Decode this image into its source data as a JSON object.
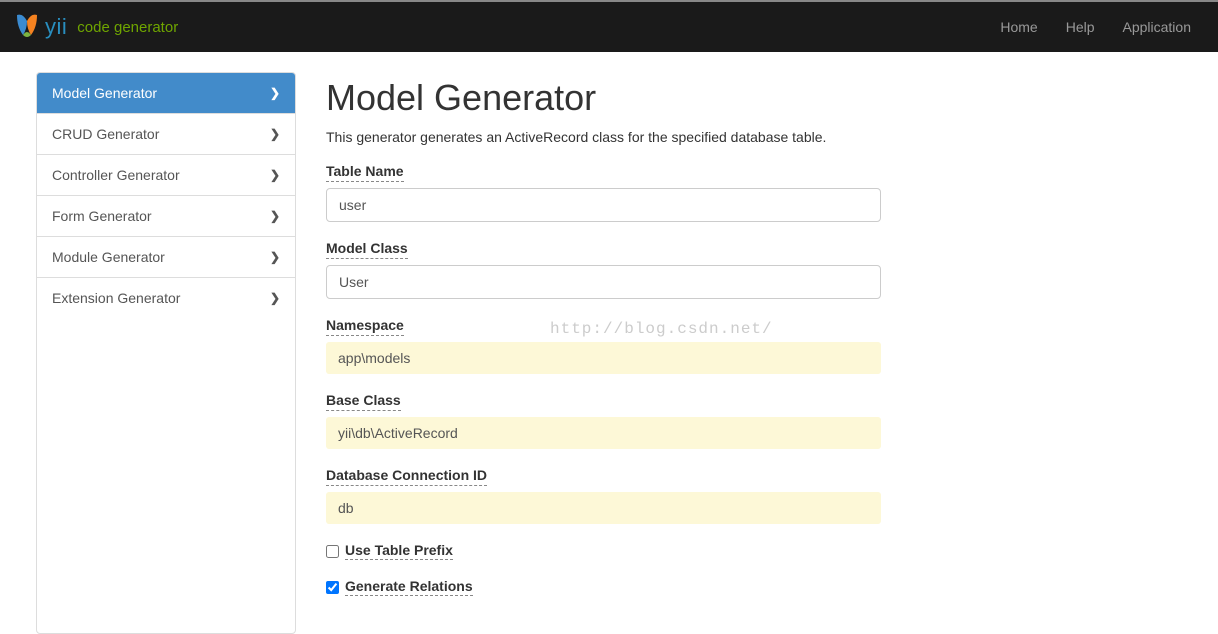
{
  "brand": {
    "yii": "yii",
    "sub": "code generator"
  },
  "nav": {
    "home": "Home",
    "help": "Help",
    "application": "Application"
  },
  "sidebar": {
    "items": [
      {
        "label": "Model Generator",
        "active": true
      },
      {
        "label": "CRUD Generator",
        "active": false
      },
      {
        "label": "Controller Generator",
        "active": false
      },
      {
        "label": "Form Generator",
        "active": false
      },
      {
        "label": "Module Generator",
        "active": false
      },
      {
        "label": "Extension Generator",
        "active": false
      }
    ]
  },
  "main": {
    "title": "Model Generator",
    "description": "This generator generates an ActiveRecord class for the specified database table.",
    "fields": {
      "table_name": {
        "label": "Table Name",
        "value": "user"
      },
      "model_class": {
        "label": "Model Class",
        "value": "User"
      },
      "namespace": {
        "label": "Namespace",
        "value": "app\\models"
      },
      "base_class": {
        "label": "Base Class",
        "value": "yii\\db\\ActiveRecord"
      },
      "db_conn": {
        "label": "Database Connection ID",
        "value": "db"
      },
      "use_table_prefix": {
        "label": "Use Table Prefix",
        "checked": false
      },
      "generate_relations": {
        "label": "Generate Relations",
        "checked": true
      }
    }
  },
  "watermark": "http://blog.csdn.net/"
}
